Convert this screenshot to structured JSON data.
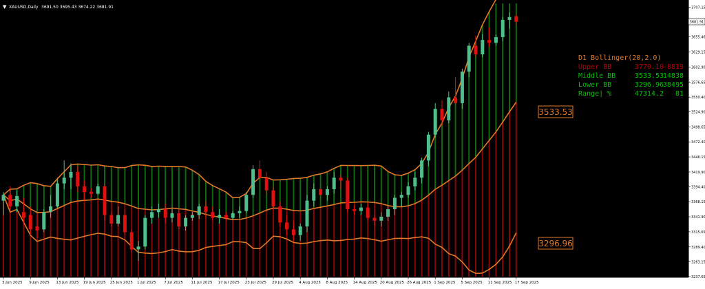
{
  "header": {
    "symbol_label": "XAUUSD,Daily",
    "ohlc": "3691.50 3695.43 3674.22 3681.91",
    "menu_icon": "triangle-down-icon"
  },
  "chart_data": {
    "type": "candlestick",
    "title": "XAUUSD,Daily",
    "ylim": [
      3237.6,
      3713.7
    ],
    "y_ticks": [
      "3707.15",
      "3681.91",
      "3655.46",
      "3629.15",
      "3602.90",
      "3576.65",
      "3550.40",
      "3524.90",
      "3498.65",
      "3472.40",
      "3446.15",
      "3419.90",
      "3394.40",
      "3368.15",
      "3341.90",
      "3315.65",
      "3289.40",
      "3263.15",
      "3237.65"
    ],
    "last_price": "3681.91",
    "x_labels": [
      "3 Jun 2025",
      "9 Jun 2025",
      "13 Jun 2025",
      "19 Jun 2025",
      "25 Jun 2025",
      "1 Jul 2025",
      "7 Jul 2025",
      "11 Jul 2025",
      "17 Jul 2025",
      "23 Jul 2025",
      "29 Jul 2025",
      "4 Aug 2025",
      "8 Aug 2025",
      "14 Aug 2025",
      "20 Aug 2025",
      "26 Aug 2025",
      "1 Sep 2025",
      "5 Sep 2025",
      "11 Sep 2025",
      "17 Sep 2025"
    ],
    "x_label_index": [
      0,
      4,
      8,
      12,
      16,
      20,
      24,
      28,
      32,
      36,
      40,
      44,
      48,
      52,
      56,
      60,
      64,
      68,
      72,
      76
    ],
    "candles": [
      {
        "o": 3370,
        "h": 3385,
        "l": 3345,
        "c": 3380
      },
      {
        "o": 3380,
        "h": 3395,
        "l": 3355,
        "c": 3360
      },
      {
        "o": 3360,
        "h": 3388,
        "l": 3350,
        "c": 3378
      },
      {
        "o": 3350,
        "h": 3375,
        "l": 3330,
        "c": 3340
      },
      {
        "o": 3345,
        "h": 3360,
        "l": 3310,
        "c": 3320
      },
      {
        "o": 3325,
        "h": 3345,
        "l": 3305,
        "c": 3318
      },
      {
        "o": 3320,
        "h": 3355,
        "l": 3315,
        "c": 3350
      },
      {
        "o": 3350,
        "h": 3380,
        "l": 3340,
        "c": 3360
      },
      {
        "o": 3360,
        "h": 3410,
        "l": 3355,
        "c": 3400
      },
      {
        "o": 3400,
        "h": 3440,
        "l": 3390,
        "c": 3410
      },
      {
        "o": 3410,
        "h": 3435,
        "l": 3390,
        "c": 3420
      },
      {
        "o": 3420,
        "h": 3430,
        "l": 3385,
        "c": 3395
      },
      {
        "o": 3395,
        "h": 3405,
        "l": 3370,
        "c": 3385
      },
      {
        "o": 3385,
        "h": 3392,
        "l": 3375,
        "c": 3382
      },
      {
        "o": 3382,
        "h": 3400,
        "l": 3380,
        "c": 3395
      },
      {
        "o": 3395,
        "h": 3400,
        "l": 3335,
        "c": 3345
      },
      {
        "o": 3345,
        "h": 3350,
        "l": 3325,
        "c": 3330
      },
      {
        "o": 3330,
        "h": 3360,
        "l": 3325,
        "c": 3345
      },
      {
        "o": 3345,
        "h": 3355,
        "l": 3310,
        "c": 3315
      },
      {
        "o": 3315,
        "h": 3320,
        "l": 3280,
        "c": 3285
      },
      {
        "o": 3285,
        "h": 3300,
        "l": 3265,
        "c": 3290
      },
      {
        "o": 3290,
        "h": 3345,
        "l": 3285,
        "c": 3340
      },
      {
        "o": 3340,
        "h": 3360,
        "l": 3330,
        "c": 3350
      },
      {
        "o": 3350,
        "h": 3365,
        "l": 3340,
        "c": 3355
      },
      {
        "o": 3355,
        "h": 3365,
        "l": 3330,
        "c": 3340
      },
      {
        "o": 3340,
        "h": 3355,
        "l": 3332,
        "c": 3348
      },
      {
        "o": 3348,
        "h": 3355,
        "l": 3320,
        "c": 3325
      },
      {
        "o": 3325,
        "h": 3345,
        "l": 3318,
        "c": 3340
      },
      {
        "o": 3340,
        "h": 3350,
        "l": 3335,
        "c": 3345
      },
      {
        "o": 3345,
        "h": 3365,
        "l": 3338,
        "c": 3360
      },
      {
        "o": 3360,
        "h": 3370,
        "l": 3340,
        "c": 3350
      },
      {
        "o": 3350,
        "h": 3360,
        "l": 3335,
        "c": 3340
      },
      {
        "o": 3340,
        "h": 3355,
        "l": 3330,
        "c": 3345
      },
      {
        "o": 3345,
        "h": 3350,
        "l": 3335,
        "c": 3340
      },
      {
        "o": 3340,
        "h": 3352,
        "l": 3337,
        "c": 3348
      },
      {
        "o": 3348,
        "h": 3360,
        "l": 3340,
        "c": 3352
      },
      {
        "o": 3352,
        "h": 3385,
        "l": 3348,
        "c": 3380
      },
      {
        "o": 3380,
        "h": 3432,
        "l": 3375,
        "c": 3425
      },
      {
        "o": 3425,
        "h": 3440,
        "l": 3405,
        "c": 3410
      },
      {
        "o": 3410,
        "h": 3420,
        "l": 3380,
        "c": 3388
      },
      {
        "o": 3388,
        "h": 3395,
        "l": 3355,
        "c": 3360
      },
      {
        "o": 3360,
        "h": 3368,
        "l": 3325,
        "c": 3332
      },
      {
        "o": 3332,
        "h": 3345,
        "l": 3310,
        "c": 3320
      },
      {
        "o": 3320,
        "h": 3335,
        "l": 3300,
        "c": 3310
      },
      {
        "o": 3310,
        "h": 3330,
        "l": 3300,
        "c": 3325
      },
      {
        "o": 3325,
        "h": 3380,
        "l": 3315,
        "c": 3370
      },
      {
        "o": 3370,
        "h": 3400,
        "l": 3360,
        "c": 3390
      },
      {
        "o": 3390,
        "h": 3400,
        "l": 3370,
        "c": 3380
      },
      {
        "o": 3380,
        "h": 3395,
        "l": 3370,
        "c": 3390
      },
      {
        "o": 3390,
        "h": 3420,
        "l": 3382,
        "c": 3410
      },
      {
        "o": 3410,
        "h": 3415,
        "l": 3390,
        "c": 3405
      },
      {
        "o": 3405,
        "h": 3410,
        "l": 3350,
        "c": 3355
      },
      {
        "o": 3355,
        "h": 3362,
        "l": 3345,
        "c": 3352
      },
      {
        "o": 3352,
        "h": 3365,
        "l": 3345,
        "c": 3358
      },
      {
        "o": 3358,
        "h": 3365,
        "l": 3335,
        "c": 3340
      },
      {
        "o": 3340,
        "h": 3345,
        "l": 3325,
        "c": 3335
      },
      {
        "o": 3335,
        "h": 3350,
        "l": 3325,
        "c": 3342
      },
      {
        "o": 3342,
        "h": 3360,
        "l": 3335,
        "c": 3355
      },
      {
        "o": 3355,
        "h": 3380,
        "l": 3345,
        "c": 3375
      },
      {
        "o": 3375,
        "h": 3385,
        "l": 3360,
        "c": 3380
      },
      {
        "o": 3380,
        "h": 3402,
        "l": 3375,
        "c": 3395
      },
      {
        "o": 3395,
        "h": 3420,
        "l": 3388,
        "c": 3410
      },
      {
        "o": 3410,
        "h": 3445,
        "l": 3400,
        "c": 3440
      },
      {
        "o": 3440,
        "h": 3490,
        "l": 3430,
        "c": 3485
      },
      {
        "o": 3485,
        "h": 3540,
        "l": 3480,
        "c": 3530
      },
      {
        "o": 3530,
        "h": 3545,
        "l": 3500,
        "c": 3510
      },
      {
        "o": 3510,
        "h": 3560,
        "l": 3505,
        "c": 3550
      },
      {
        "o": 3550,
        "h": 3585,
        "l": 3535,
        "c": 3540
      },
      {
        "o": 3540,
        "h": 3600,
        "l": 3530,
        "c": 3595
      },
      {
        "o": 3595,
        "h": 3645,
        "l": 3585,
        "c": 3640
      },
      {
        "o": 3640,
        "h": 3658,
        "l": 3620,
        "c": 3625
      },
      {
        "o": 3625,
        "h": 3660,
        "l": 3620,
        "c": 3650
      },
      {
        "o": 3650,
        "h": 3672,
        "l": 3638,
        "c": 3645
      },
      {
        "o": 3645,
        "h": 3660,
        "l": 3640,
        "c": 3655
      },
      {
        "o": 3655,
        "h": 3690,
        "l": 3648,
        "c": 3685
      },
      {
        "o": 3685,
        "h": 3698,
        "l": 3670,
        "c": 3690
      },
      {
        "o": 3691.5,
        "h": 3695.43,
        "l": 3674.22,
        "c": 3681.91
      }
    ],
    "middle_bb_label": "3533.53",
    "lower_bb_label": "3296.96"
  },
  "indicator": {
    "title": "D1 Bollinger(20,2.0)",
    "rows": [
      {
        "name": "Upper BB",
        "value": "3770.10",
        "extra": "-8819",
        "color": "#b00000"
      },
      {
        "name": "Middle BB",
        "value": "3533.53",
        "extra": "14838",
        "color": "#00c000"
      },
      {
        "name": "Lower BB",
        "value": "3296.96",
        "extra": "38495",
        "color": "#00c000"
      },
      {
        "name": "Range| %",
        "value": "47314.2",
        "extra": "81",
        "color": "#00c000"
      }
    ]
  },
  "colors": {
    "background": "#000000",
    "bull": "#4fc08d",
    "bear": "#e01010",
    "band_upper_fill": "#0f6a0f",
    "band_lower_fill": "#8a0505",
    "band_line": "#e07a2a",
    "title_text": "#e07a2a",
    "axis_bg": "#ffffff",
    "axis_text": "#000000"
  }
}
